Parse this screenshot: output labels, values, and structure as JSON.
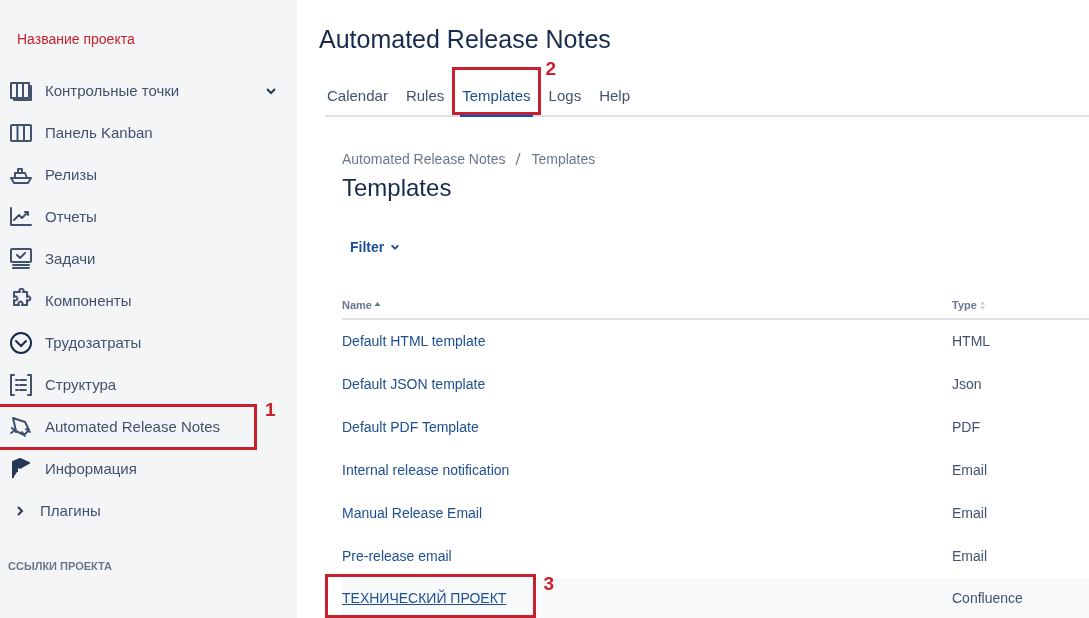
{
  "sidebar": {
    "project_name": "Название проекта",
    "items": [
      {
        "label": "Контрольные точки",
        "kind": "dropdown",
        "expanded": false
      },
      {
        "label": "Панель Kanban",
        "kind": "item"
      },
      {
        "label": "Релизы",
        "kind": "item"
      },
      {
        "label": "Отчеты",
        "kind": "item"
      },
      {
        "label": "Задачи",
        "kind": "item"
      },
      {
        "label": "Компоненты",
        "kind": "item"
      },
      {
        "label": "Трудозатраты",
        "kind": "item"
      },
      {
        "label": "Структура",
        "kind": "item"
      },
      {
        "label": "Automated Release Notes",
        "kind": "item",
        "annotation": "1"
      },
      {
        "label": "Информация",
        "kind": "item"
      },
      {
        "label": "Плагины",
        "kind": "group",
        "expanded": false
      }
    ],
    "section_heading": "ССЫЛКИ ПРОЕКТА"
  },
  "page_title": "Automated Release Notes",
  "tabs": [
    {
      "label": "Calendar",
      "selected": false
    },
    {
      "label": "Rules",
      "selected": false
    },
    {
      "label": "Templates",
      "selected": true,
      "annotation": "2"
    },
    {
      "label": "Logs",
      "selected": false
    },
    {
      "label": "Help",
      "selected": false
    }
  ],
  "breadcrumb": [
    "Automated Release Notes",
    "Templates"
  ],
  "heading": "Templates",
  "filter": {
    "label": "Filter"
  },
  "table": {
    "columns": [
      {
        "label": "Name",
        "sorted": true
      },
      {
        "label": "Type",
        "sorted": false
      }
    ],
    "rows": [
      {
        "name": "Default HTML template",
        "type": "HTML",
        "highlighted": false
      },
      {
        "name": "Default JSON template",
        "type": "Json",
        "highlighted": false
      },
      {
        "name": "Default PDF Template",
        "type": "PDF",
        "highlighted": false
      },
      {
        "name": "Internal release notification",
        "type": "Email",
        "highlighted": false
      },
      {
        "name": "Manual Release Email",
        "type": "Email",
        "highlighted": false
      },
      {
        "name": "Pre-release email",
        "type": "Email",
        "highlighted": false
      },
      {
        "name": "ТЕХНИЧЕСКИЙ ПРОЕКТ",
        "type": "Confluence",
        "highlighted": true,
        "annotation": "3"
      }
    ]
  }
}
